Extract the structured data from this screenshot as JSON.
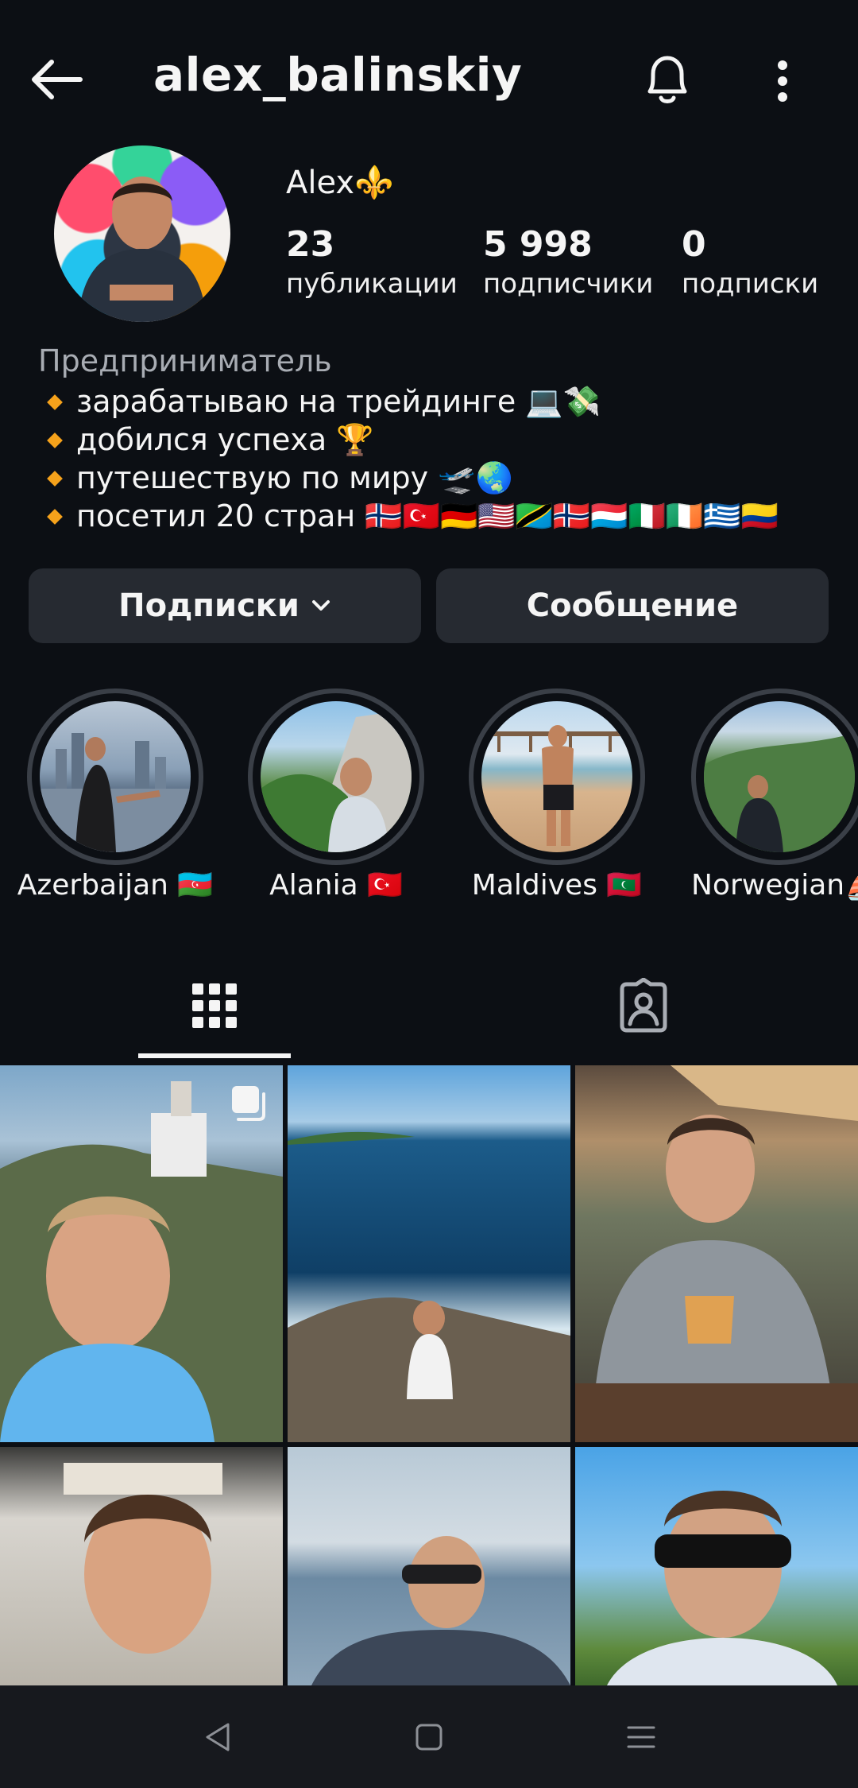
{
  "header": {
    "username": "alex_balinskiy",
    "back_icon": "arrow-left-icon",
    "bell_icon": "bell-icon",
    "more_icon": "more-vertical-icon"
  },
  "profile": {
    "name": "Alex⚜️",
    "stats": [
      {
        "value": "23",
        "label": "публикации"
      },
      {
        "value": "5 998",
        "label": "подписчики"
      },
      {
        "value": "0",
        "label": "подписки"
      }
    ],
    "category": "Предприниматель",
    "bio": [
      "зарабатываю на трейдинге 💻💸",
      "добился успеха 🏆",
      "путешествую по миру 🛫🌏",
      "посетил 20 стран 🇳🇴🇹🇷🇩🇪🇺🇸🇹🇿🇳🇴🇱🇺🇮🇹🇮🇪🇬🇷🇨🇴"
    ]
  },
  "actions": {
    "following_label": "Подписки",
    "message_label": "Сообщение"
  },
  "highlights": [
    {
      "label": "Azerbaijan 🇦🇿"
    },
    {
      "label": "Alania 🇹🇷"
    },
    {
      "label": "Maldives 🇲🇻"
    },
    {
      "label": "Norwegian⛵"
    }
  ],
  "tabs": {
    "grid_icon": "grid-icon",
    "tagged_icon": "tagged-person-icon"
  },
  "colors": {
    "background": "#0c0f14",
    "button": "#262a31",
    "accent_bullet": "#f6a21b"
  }
}
